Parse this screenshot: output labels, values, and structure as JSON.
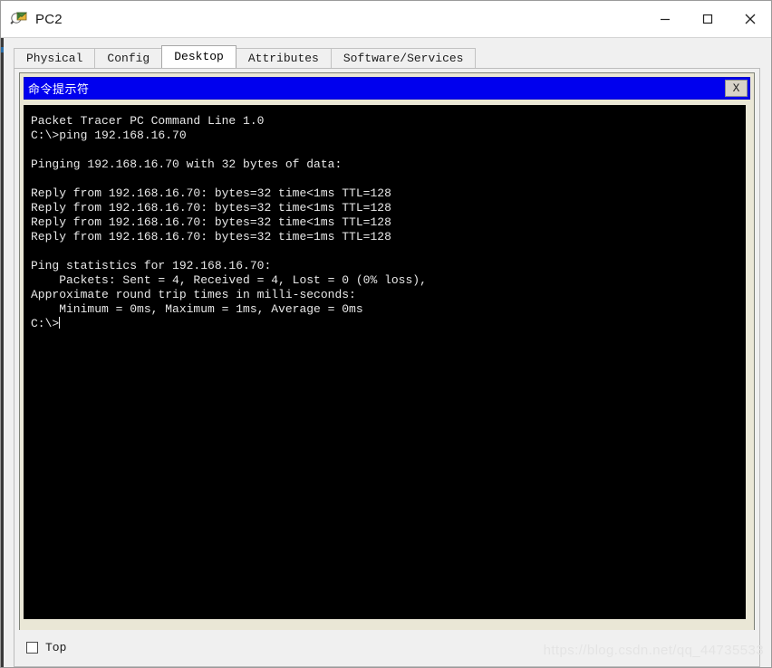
{
  "window": {
    "title": "PC2",
    "icon": "packet-tracer-pc-icon",
    "controls": {
      "minimize_label": "—",
      "maximize_label": "□",
      "close_label": "✕"
    }
  },
  "tabs": [
    {
      "label": "Physical",
      "active": false
    },
    {
      "label": "Config",
      "active": false
    },
    {
      "label": "Desktop",
      "active": true
    },
    {
      "label": "Attributes",
      "active": false
    },
    {
      "label": "Software/Services",
      "active": false
    }
  ],
  "cmd_window": {
    "title": "命令提示符",
    "close_label": "X",
    "titlebar_color": "#0000ee",
    "terminal_bg": "#000000",
    "terminal_fg": "#e8e8e8",
    "terminal_text": "Packet Tracer PC Command Line 1.0\nC:\\>ping 192.168.16.70\n\nPinging 192.168.16.70 with 32 bytes of data:\n\nReply from 192.168.16.70: bytes=32 time<1ms TTL=128\nReply from 192.168.16.70: bytes=32 time<1ms TTL=128\nReply from 192.168.16.70: bytes=32 time<1ms TTL=128\nReply from 192.168.16.70: bytes=32 time=1ms TTL=128\n\nPing statistics for 192.168.16.70:\n    Packets: Sent = 4, Received = 4, Lost = 0 (0% loss),\nApproximate round trip times in milli-seconds:\n    Minimum = 0ms, Maximum = 1ms, Average = 0ms\n",
    "prompt": "C:\\>"
  },
  "bottom": {
    "top_checkbox_label": "Top",
    "top_checkbox_checked": false
  },
  "watermark": "https://blog.csdn.net/qq_44735533"
}
